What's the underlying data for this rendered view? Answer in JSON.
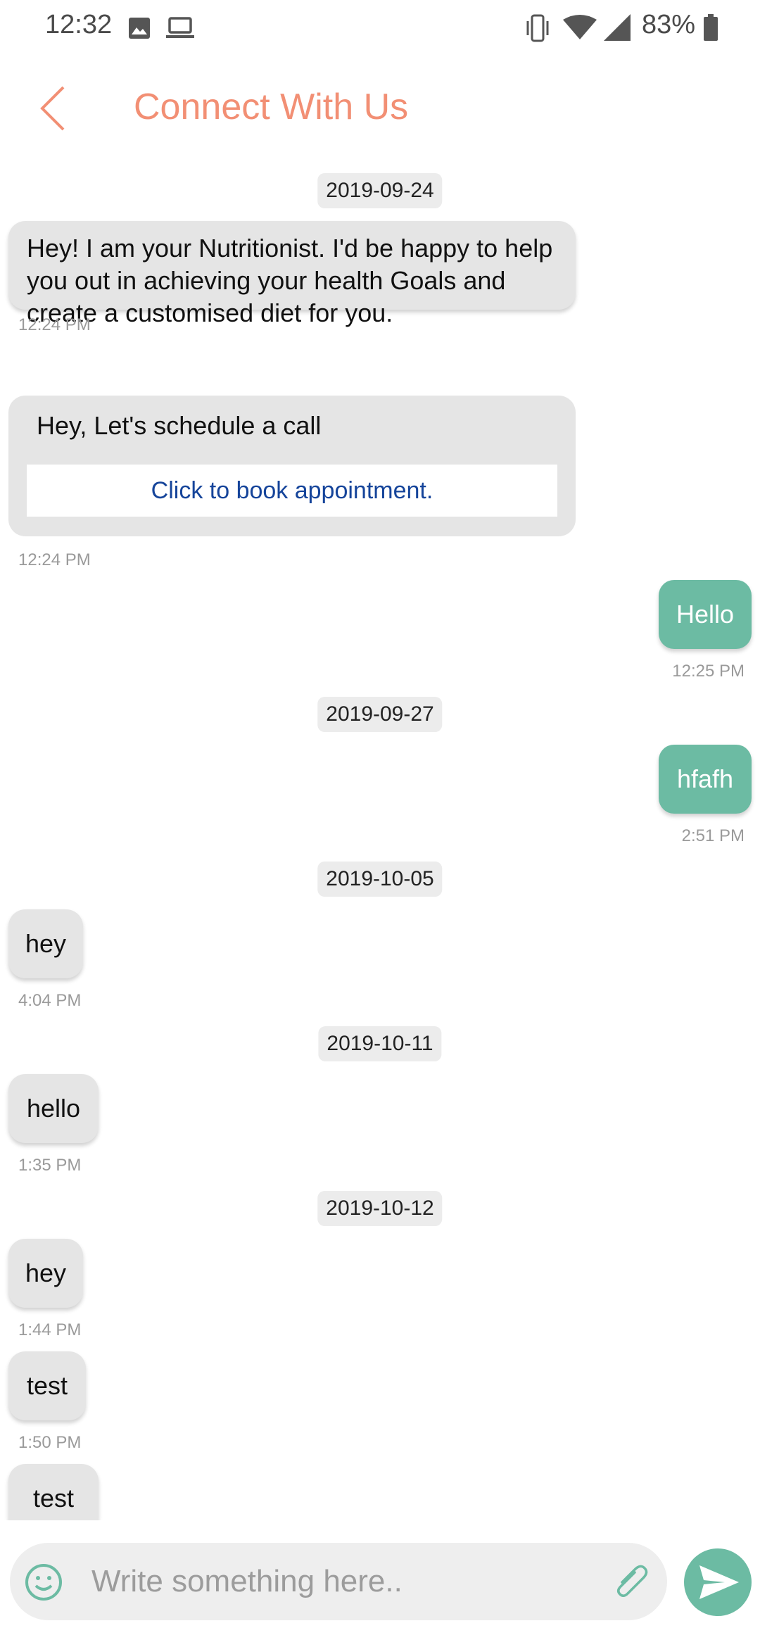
{
  "status_bar": {
    "time": "12:32",
    "battery": "83%",
    "icons": [
      "image-icon",
      "laptop-icon",
      "vibrate-icon",
      "wifi-icon",
      "signal-icon",
      "battery-icon"
    ]
  },
  "header": {
    "title": "Connect With Us",
    "back_icon": "chevron-left-icon"
  },
  "colors": {
    "accent": "#f28f74",
    "outgoing_bubble": "#6cbba3",
    "incoming_bubble": "#e5e5e5",
    "link": "#15449a"
  },
  "messages": {
    "date1": "2019-09-24",
    "m1_text": "Hey! I am your Nutritionist. I'd be happy to help you out in achieving your health Goals and create a customised diet for you.",
    "m1_time": "12:24 PM",
    "m2_text": "Hey, Let's schedule a call",
    "m2_link": "Click to book appointment.",
    "m2_time": "12:24 PM",
    "m3_text": "Hello",
    "m3_time": "12:25 PM",
    "date2": "2019-09-27",
    "m4_text": "hfafh",
    "m4_time": "2:51 PM",
    "date3": "2019-10-05",
    "m5_text": "hey",
    "m5_time": "4:04 PM",
    "date4": "2019-10-11",
    "m6_text": "hello",
    "m6_time": "1:35 PM",
    "date5": "2019-10-12",
    "m7_text": "hey",
    "m7_time": "1:44 PM",
    "m8_text": "test",
    "m8_time": "1:50 PM",
    "m9_text": "test"
  },
  "composer": {
    "placeholder": "Write something here..",
    "emoji_icon": "smiley-icon",
    "attach_icon": "paperclip-icon",
    "send_icon": "send-icon"
  }
}
